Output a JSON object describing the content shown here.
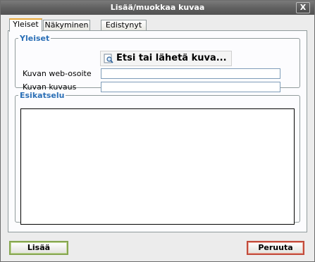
{
  "window": {
    "title": "Lisää/muokkaa kuvaa",
    "close_glyph": "X"
  },
  "tabs": [
    {
      "label": "Yleiset",
      "active": true
    },
    {
      "label": "Näkyminen",
      "active": false
    },
    {
      "label": "Edistynyt",
      "active": false
    }
  ],
  "general": {
    "legend": "Yleiset",
    "browse_label": "Etsi tai lähetä kuva...",
    "browse_icon": "browse-image-icon",
    "url_label": "Kuvan web-osoite",
    "url_value": "",
    "desc_label": "Kuvan kuvaus",
    "desc_value": ""
  },
  "preview": {
    "legend": "Esikatselu"
  },
  "footer": {
    "ok_label": "Lisää",
    "cancel_label": "Peruuta"
  },
  "colors": {
    "legend": "#2b6fb6",
    "ok_border": "#86a650",
    "cancel_border": "#c24b3b",
    "active_tab_accent": "#e9a93a"
  }
}
